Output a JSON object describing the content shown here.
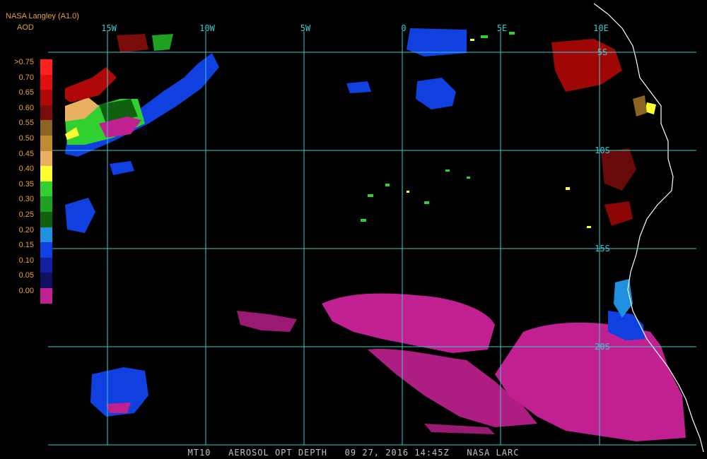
{
  "header": {
    "source": "NASA Langley (A1.0)",
    "product": "AOD"
  },
  "legend": [
    {
      "label": ">0.75",
      "color": "#ff2020"
    },
    {
      "label": "0.70",
      "color": "#e01010"
    },
    {
      "label": "0.65",
      "color": "#b00808"
    },
    {
      "label": "0.60",
      "color": "#7a0c0c"
    },
    {
      "label": "0.55",
      "color": "#8a6420"
    },
    {
      "label": "0.50",
      "color": "#c08a30"
    },
    {
      "label": "0.45",
      "color": "#e8b060"
    },
    {
      "label": "0.40",
      "color": "#ffff30"
    },
    {
      "label": "0.35",
      "color": "#30d030"
    },
    {
      "label": "0.30",
      "color": "#20a020"
    },
    {
      "label": "0.25",
      "color": "#106010"
    },
    {
      "label": "0.20",
      "color": "#2090e0"
    },
    {
      "label": "0.15",
      "color": "#1040e0"
    },
    {
      "label": "0.10",
      "color": "#1020a0"
    },
    {
      "label": "0.05",
      "color": "#101060"
    },
    {
      "label": "0.00",
      "color": "#c02090"
    }
  ],
  "grid": {
    "color": "#40c8d0",
    "lon_labels": [
      "15W",
      "10W",
      "5W",
      "0",
      "5E",
      "10E"
    ],
    "lat_labels": [
      "5S",
      "10S",
      "15S",
      "20S"
    ]
  },
  "colors": {
    "coastline": "#ffffff",
    "background": "#000000"
  },
  "footer": {
    "satellite": "MT10",
    "product": "AEROSOL OPT DEPTH",
    "datetime": "09 27, 2016 14:45Z",
    "agency": "NASA LARC"
  }
}
